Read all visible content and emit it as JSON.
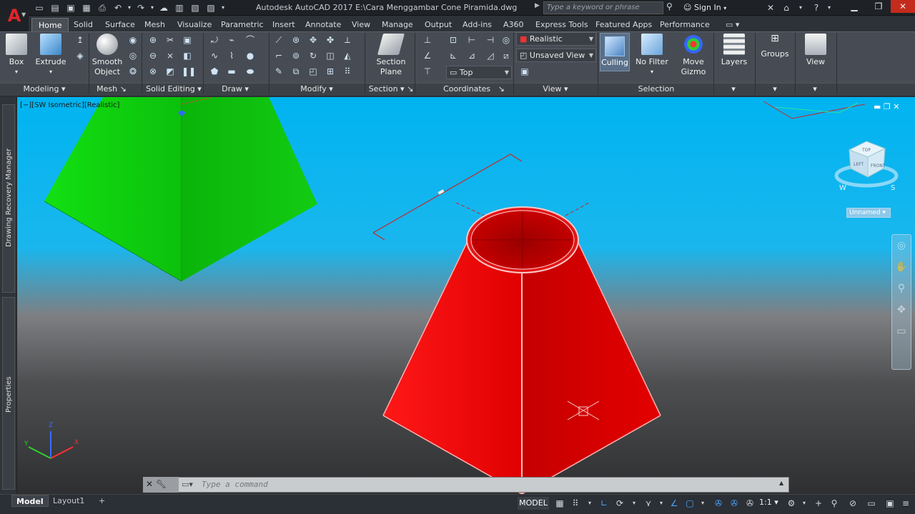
{
  "window": {
    "title": "Autodesk AutoCAD 2017    E:\\Cara Menggambar Cone Piramida.dwg",
    "workspace_tab": "A360",
    "search_placeholder": "Type a keyword or phrase",
    "sign_in": "Sign In"
  },
  "tabs": [
    "Home",
    "Solid",
    "Surface",
    "Mesh",
    "Visualize",
    "Parametric",
    "Insert",
    "Annotate",
    "View",
    "Manage",
    "Output",
    "Add-ins",
    "A360",
    "Express Tools",
    "Featured Apps",
    "Performance"
  ],
  "ribbon": {
    "box": "Box",
    "extrude": "Extrude",
    "smooth_object": "Smooth Object",
    "section_plane": "Section Plane",
    "culling": "Culling",
    "no_filter": "No Filter",
    "move_gizmo": "Move Gizmo",
    "layers": "Layers",
    "groups": "Groups",
    "view": "View",
    "visual_style": "Realistic",
    "named_view": "Unsaved View",
    "ucs_view": "Top",
    "panels": {
      "modeling": "Modeling",
      "mesh": "Mesh",
      "solid_editing": "Solid Editing",
      "draw": "Draw",
      "modify": "Modify",
      "section": "Section",
      "coordinates": "Coordinates",
      "view": "View",
      "selection": "Selection"
    }
  },
  "viewport": {
    "label": "[−][SW Isometric][Realistic]",
    "ucs_name": "Unnamed",
    "cube_faces": {
      "top": "TOP",
      "front": "FRONT",
      "left": "LEFT"
    },
    "compass": {
      "w": "W",
      "s": "S"
    }
  },
  "rails": {
    "recovery": "Drawing Recovery Manager",
    "properties": "Properties"
  },
  "command": {
    "placeholder": "Type a command"
  },
  "status": {
    "model_tab": "Model",
    "layout_tab": "Layout1",
    "model_space": "MODEL",
    "scale": "1:1"
  },
  "colors": {
    "green_solid": "#14d414",
    "red_solid": "#e01010",
    "sky": "#00b4f0",
    "ribbon": "#474c54"
  }
}
